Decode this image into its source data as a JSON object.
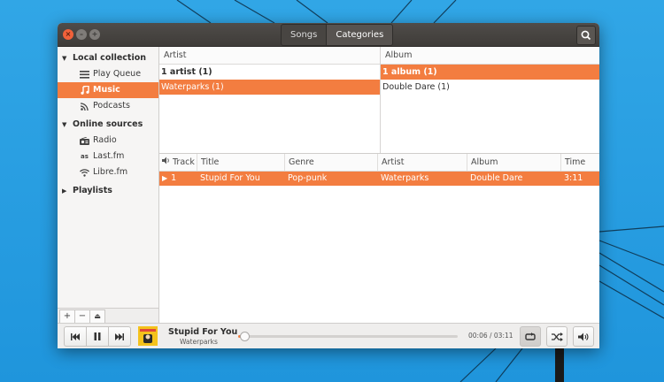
{
  "window": {
    "view_tabs": [
      "Songs",
      "Categories"
    ],
    "active_tab": "Categories",
    "accent": "#f37d40"
  },
  "sidebar": {
    "sections": [
      {
        "label": "Local collection",
        "expanded": true,
        "items": [
          {
            "label": "Play Queue",
            "icon": "list-icon"
          },
          {
            "label": "Music",
            "icon": "music-note-icon",
            "active": true
          },
          {
            "label": "Podcasts",
            "icon": "rss-icon"
          }
        ]
      },
      {
        "label": "Online sources",
        "expanded": true,
        "items": [
          {
            "label": "Radio",
            "icon": "radio-icon"
          },
          {
            "label": "Last.fm",
            "icon": "lastfm-icon"
          },
          {
            "label": "Libre.fm",
            "icon": "wifi-icon"
          }
        ]
      },
      {
        "label": "Playlists",
        "expanded": false,
        "items": []
      }
    ],
    "tools": [
      "+",
      "−",
      "⏏"
    ]
  },
  "browser": {
    "artist": {
      "header": "Artist",
      "rows": [
        "1 artist (1)",
        "Waterparks (1)"
      ]
    },
    "album": {
      "header": "Album",
      "rows": [
        "1 album (1)",
        "Double Dare (1)"
      ]
    }
  },
  "tracks": {
    "columns": {
      "track": "Track",
      "title": "Title",
      "genre": "Genre",
      "artist": "Artist",
      "album": "Album",
      "time": "Time"
    },
    "rows": [
      {
        "track": "1",
        "title": "Stupid For You",
        "genre": "Pop-punk",
        "artist": "Waterparks",
        "album": "Double Dare",
        "time": "3:11",
        "playing": true
      }
    ]
  },
  "player": {
    "title": "Stupid For You",
    "artist": "Waterparks",
    "time": "00:06 / 03:11",
    "progress": 0.03,
    "repeat_on": true
  }
}
